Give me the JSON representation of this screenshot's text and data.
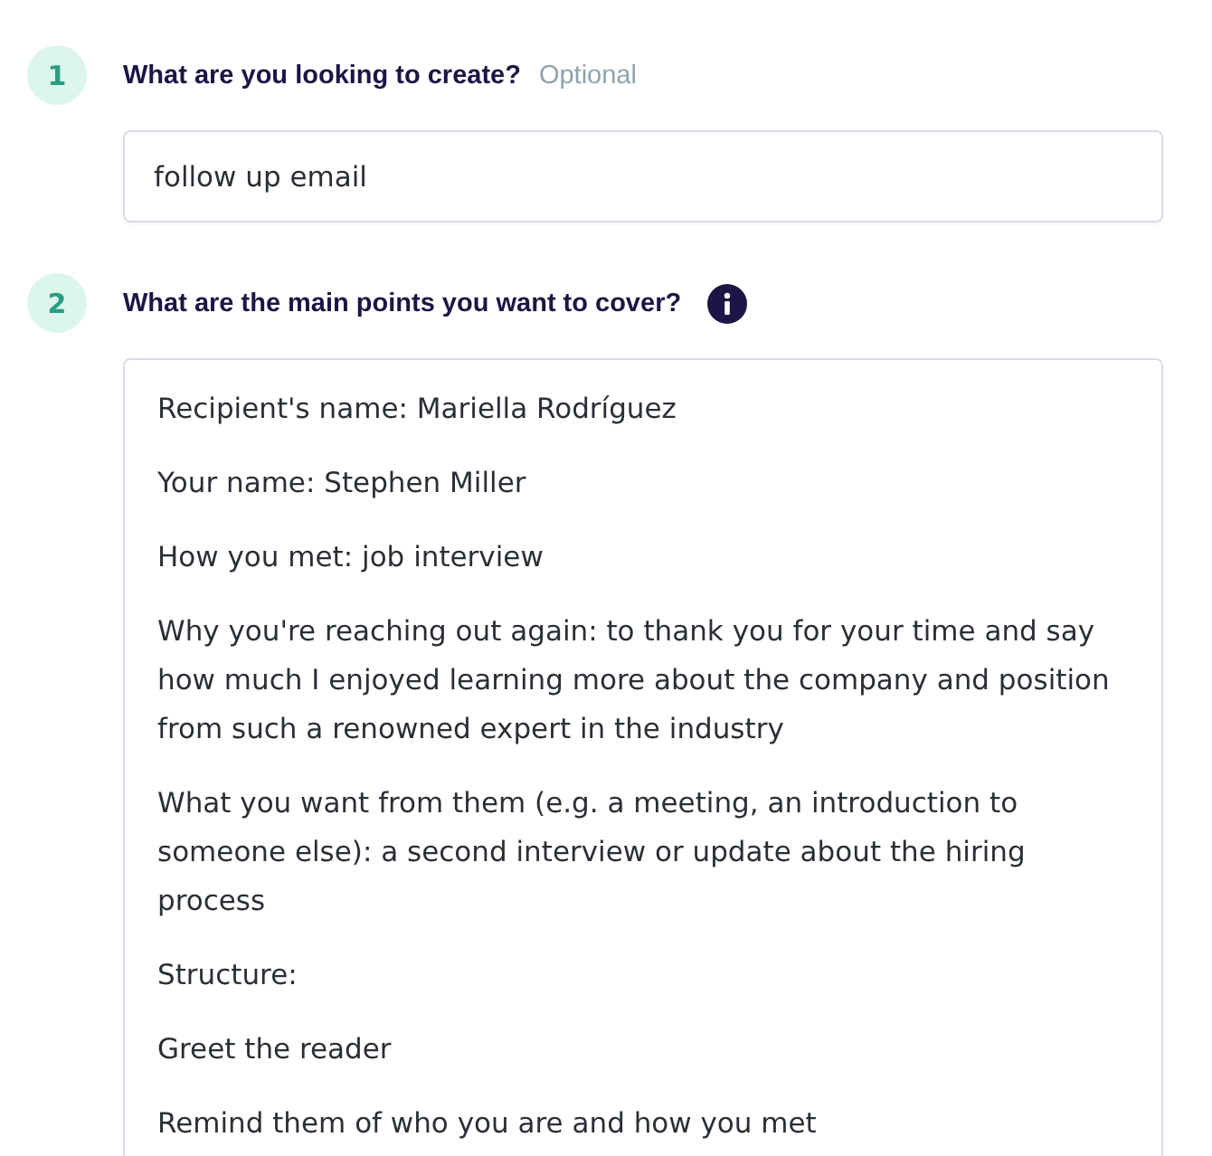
{
  "steps": [
    {
      "number": "1",
      "question": "What are you looking to create?",
      "optional_label": "Optional",
      "kind": "input",
      "value": "follow up email"
    },
    {
      "number": "2",
      "question": "What are the main points you want to cover?",
      "info": true,
      "kind": "textarea",
      "paragraphs": [
        "Recipient's name: Mariella Rodríguez",
        "Your name: Stephen Miller",
        "How you met: job interview",
        "Why you're reaching out again: to thank you for your time and say how much I enjoyed learning more about the company and position from such a renowned expert in the industry",
        "What you want from them (e.g. a meeting, an introduction to someone else): a second interview or update about the hiring process",
        "Structure:",
        "Greet the reader",
        "Remind them of who you are and how you met"
      ]
    }
  ]
}
